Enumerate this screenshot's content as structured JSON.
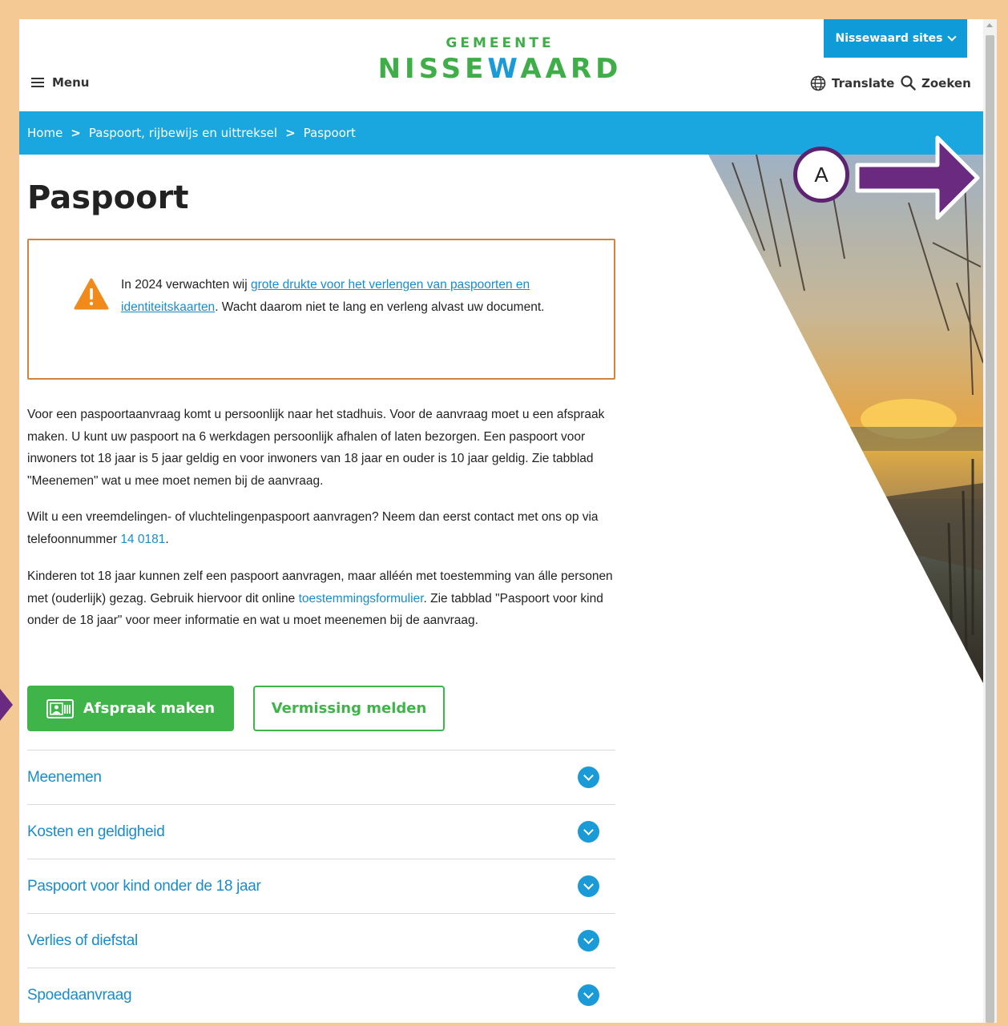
{
  "header": {
    "menu_label": "Menu",
    "logo_top": "GEMEENTE",
    "logo_main_part1": "NISSE",
    "logo_main_w": "W",
    "logo_main_part2": "AARD",
    "sites_label": "Nissewaard sites",
    "translate_label": "Translate",
    "search_label": "Zoeken"
  },
  "breadcrumb": {
    "items": [
      "Home",
      "Paspoort, rijbewijs en uittreksel",
      "Paspoort"
    ],
    "separator": ">"
  },
  "page": {
    "title": "Paspoort"
  },
  "notice": {
    "text_before": "In 2024 verwachten wij ",
    "link": "grote drukte voor het verlengen van paspoorten en identiteitskaarten",
    "text_after": ". Wacht daarom niet te lang en verleng alvast uw document."
  },
  "content": {
    "p1": "Voor een paspoortaanvraag komt u persoonlijk naar het stadhuis. Voor de aanvraag moet u een afspraak maken. U kunt uw paspoort na 6 werkdagen persoonlijk afhalen of laten bezorgen. Een paspoort voor inwoners tot 18 jaar is 5 jaar geldig en voor inwoners van 18 jaar en ouder is 10 jaar geldig. Zie tabblad \"Meenemen\" wat u mee moet nemen bij de aanvraag.",
    "p2_before": "Wilt u een vreemdelingen- of vluchtelingenpaspoort aanvragen? Neem dan eerst contact met ons op via telefoonnummer ",
    "p2_link": "14 0181",
    "p2_after": ".",
    "p3_before": "Kinderen tot 18 jaar kunnen zelf een paspoort aanvragen, maar alléén met toestemming van álle personen met (ouderlijk) gezag. Gebruik hiervoor dit online ",
    "p3_link": "toestemmingsformulier",
    "p3_after": ". Zie tabblad \"Paspoort voor kind onder de 18 jaar\" voor meer informatie en wat u moet meenemen bij de aanvraag."
  },
  "buttons": {
    "primary": "Afspraak maken",
    "secondary": "Vermissing melden"
  },
  "accordion": [
    {
      "label": "Meenemen"
    },
    {
      "label": "Kosten en geldigheid"
    },
    {
      "label": "Paspoort voor kind onder de 18 jaar"
    },
    {
      "label": "Verlies of diefstal"
    },
    {
      "label": "Spoedaanvraag"
    }
  ],
  "annotation": {
    "marker_label": "A"
  },
  "colors": {
    "brand_green": "#3fb549",
    "brand_blue": "#1aa7e0",
    "link_blue": "#1a8ccb",
    "notice_border": "#d3843a",
    "annotation_purple": "#6a2a80",
    "page_border": "#f5c993"
  }
}
